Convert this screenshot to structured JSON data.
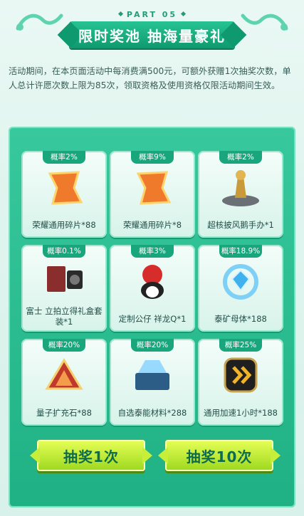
{
  "header": {
    "part_label": "PART 05",
    "title": "限时奖池 抽海量豪礼"
  },
  "description": "活动期间，在本页面活动中每消费满500元，可额外获赠1次抽奖次数，单人总计许愿次数上限为85次，领取资格及使用资格仅限活动期间生效。",
  "prizes": [
    {
      "rate": "概率2%",
      "name": "荣耀通用碎片*88",
      "icon": "honor-fragment-icon"
    },
    {
      "rate": "概率9%",
      "name": "荣耀通用碎片*8",
      "icon": "honor-fragment-icon"
    },
    {
      "rate": "概率2%",
      "name": "超核披风鹅手办*1",
      "icon": "figure-icon"
    },
    {
      "rate": "概率0.1%",
      "name": "富士 立拍立得礼盒套装*1",
      "icon": "camera-gift-icon"
    },
    {
      "rate": "概率3%",
      "name": "定制公仔 祥龙Q*1",
      "icon": "doll-icon"
    },
    {
      "rate": "概率18.9%",
      "name": "泰矿母体*188",
      "icon": "crystal-icon"
    },
    {
      "rate": "概率20%",
      "name": "量子扩充石*88",
      "icon": "quantum-stone-icon"
    },
    {
      "rate": "概率20%",
      "name": "自选泰能材料*288",
      "icon": "material-chest-icon"
    },
    {
      "rate": "概率25%",
      "name": "通用加速1小时*188",
      "icon": "speedup-icon"
    }
  ],
  "buttons": {
    "draw_once": "抽奖1次",
    "draw_ten": "抽奖10次"
  },
  "colors": {
    "accent": "#1aa67c",
    "panel": "#2bbd90",
    "button": "#c9f03a",
    "button_text": "#0e6b4d"
  }
}
